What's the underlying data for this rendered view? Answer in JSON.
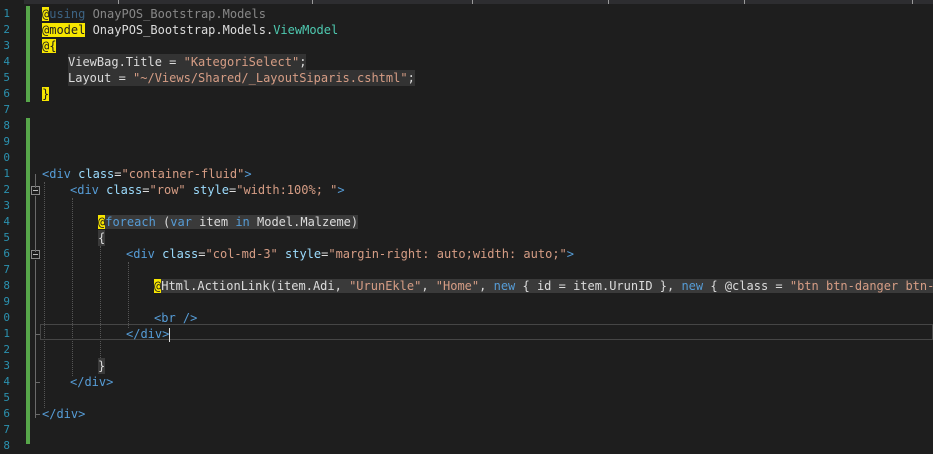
{
  "editor": {
    "line_numbers": [
      "1",
      "2",
      "3",
      "4",
      "5",
      "6",
      "7",
      "8",
      "9",
      "0",
      "1",
      "2",
      "3",
      "4",
      "5",
      "6",
      "7",
      "8",
      "9",
      "0",
      "1",
      "2",
      "3",
      "4",
      "5",
      "6",
      "7",
      "8"
    ],
    "lines": {
      "l1_at": "@",
      "l1_kw": "using",
      "l1_rest": " OnayPOS_Bootstrap.Models",
      "l2_at": "@",
      "l2_kw": "model",
      "l2_ns": " OnayPOS_Bootstrap.Models.",
      "l2_type": "ViewModel",
      "l3_at": "@",
      "l3_brace": "{",
      "l4_a": "ViewBag.Title = ",
      "l4_str": "\"KategoriSelect\"",
      "l4_end": ";",
      "l5_a": "Layout = ",
      "l5_str": "\"~/Views/Shared/_LayoutSiparis.cshtml\"",
      "l5_end": ";",
      "l6_brace": "}",
      "l10_open": "<",
      "l10_tag": "div",
      "l10_attr": " class",
      "l10_eq": "=",
      "l10_val": "\"container-fluid\"",
      "l10_close": ">",
      "l11_open": "<",
      "l11_tag": "div",
      "l11_attr1": " class",
      "l11_val1": "\"row\"",
      "l11_attr2": " style",
      "l11_val2": "\"width:100%; \"",
      "l11_close": ">",
      "l13_at": "@",
      "l13_kw": "foreach",
      "l13_p1": " (",
      "l13_var": "var",
      "l13_item": " item ",
      "l13_in": "in",
      "l13_rest": " Model.Malzeme)",
      "l14_brace": "{",
      "l15_open": "<",
      "l15_tag": "div",
      "l15_attr1": " class",
      "l15_val1": "\"col-md-3\"",
      "l15_attr2": " style",
      "l15_val2": "\"margin-right: auto;width: auto;\"",
      "l15_close": ">",
      "l17_at": "@",
      "l17_a": "Html.ActionLink(item.Adi, ",
      "l17_s1": "\"UrunEkle\"",
      "l17_c1": ", ",
      "l17_s2": "\"Home\"",
      "l17_c2": ", ",
      "l17_new1": "new",
      "l17_b": " { id = item.UrunID }, ",
      "l17_new2": "new",
      "l17_c": " { @class = ",
      "l17_s3": "\"btn btn-danger btn-xs\"",
      "l19_open": "<",
      "l19_tag": "br",
      "l19_close": " />",
      "l20_open": "</",
      "l20_tag": "div",
      "l20_close": ">",
      "l22_brace": "}",
      "l23_open": "</",
      "l23_tag": "div",
      "l23_close": ">",
      "l25_open": "</",
      "l25_tag": "div",
      "l25_close": ">"
    }
  },
  "colors": {
    "background": "#1e1e1e",
    "keyword": "#569cd6",
    "string": "#d69d85",
    "type": "#4ec9b0",
    "razor_at": "#f7e600",
    "change_bar": "#57a64a",
    "line_number": "#2b91af"
  }
}
